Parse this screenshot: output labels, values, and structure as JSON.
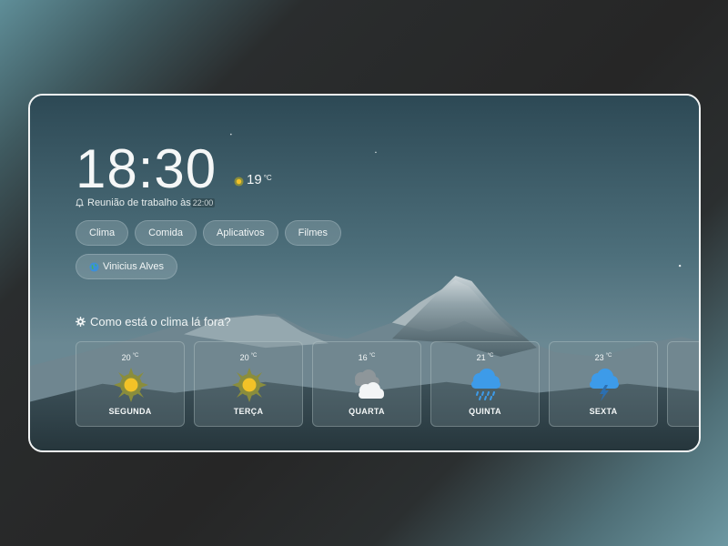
{
  "clock": {
    "time": "18:30"
  },
  "weather_now": {
    "temp": "19",
    "unit": "°C",
    "icon": "sun-icon"
  },
  "reminder": {
    "text": "Reunião de trabalho às ",
    "time": "22:00",
    "icon": "bell-icon"
  },
  "categories": [
    {
      "label": "Clima"
    },
    {
      "label": "Comida"
    },
    {
      "label": "Aplicativos"
    },
    {
      "label": "Filmes"
    }
  ],
  "user": {
    "name": "Vinicius Alves",
    "icon": "globe-icon"
  },
  "forecast_section": {
    "title": "Como está o clima lá fora?",
    "icon": "gear-icon"
  },
  "forecast": [
    {
      "day": "SEGUNDA",
      "temp": "20",
      "unit": "°C",
      "icon": "sun-icon"
    },
    {
      "day": "TERÇA",
      "temp": "20",
      "unit": "°C",
      "icon": "sun-icon"
    },
    {
      "day": "QUARTA",
      "temp": "16",
      "unit": "°C",
      "icon": "cloudy-icon"
    },
    {
      "day": "QUINTA",
      "temp": "21",
      "unit": "°C",
      "icon": "rain-cloud-icon"
    },
    {
      "day": "SEXTA",
      "temp": "23",
      "unit": "°C",
      "icon": "storm-cloud-icon"
    }
  ],
  "colors": {
    "sun": "#f2c227",
    "sun_rays": "#8a8d3c",
    "rain_cloud": "#3d9be9",
    "cloud_white": "#f3f5f6",
    "cloud_grey": "#8e969a"
  }
}
